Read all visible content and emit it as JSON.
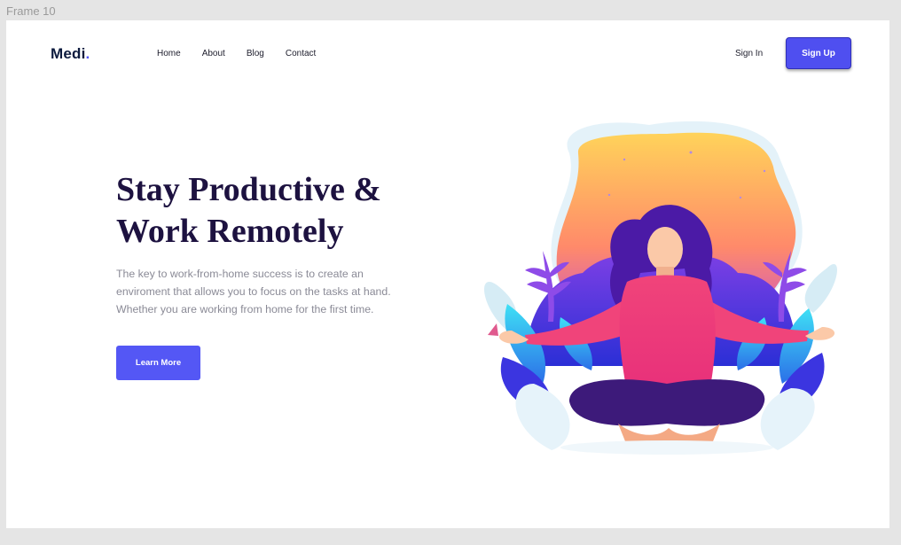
{
  "frame": {
    "label": "Frame 10"
  },
  "brand": {
    "name": "Medi",
    "dot": "."
  },
  "nav": {
    "items": [
      "Home",
      "About",
      "Blog",
      "Contact"
    ]
  },
  "auth": {
    "signin": "Sign In",
    "signup": "Sign Up"
  },
  "hero": {
    "title_lines": [
      "Stay Productive &",
      "Work Remotely"
    ],
    "description_lines": [
      "The key to work-from-home success is to create an",
      "enviroment that allows you to focus on the tasks at hand.",
      "Whether you are working from home for the first time."
    ],
    "cta": "Learn More"
  },
  "colors": {
    "accent": "#5457f5",
    "title": "#1d1240",
    "body_text": "#8a8a96",
    "sky_top": "#ffd35a",
    "sky_bottom": "#f15b9a",
    "shirt": "#f0447a",
    "hair": "#4b1aa6"
  },
  "illustration": {
    "name": "woman-meditating-illustration"
  }
}
